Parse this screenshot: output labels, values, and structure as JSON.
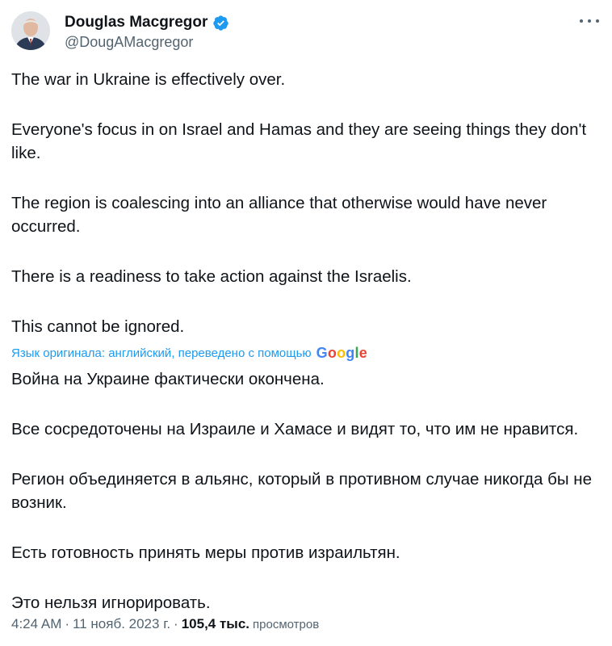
{
  "author": {
    "display_name": "Douglas Macgregor",
    "handle": "@DougAMacgregor",
    "verified_color": "#1d9bf0"
  },
  "menu": {
    "icon": "more-horizontal-icon"
  },
  "original": {
    "paragraphs": [
      "The war in Ukraine is effectively over.",
      "Everyone's focus in on Israel and Hamas and they are seeing things they don't like.",
      "The region is coalescing into an alliance that otherwise would have never occurred.",
      "There is a readiness to take action against the Israelis.",
      "This cannot be ignored."
    ]
  },
  "translation": {
    "notice": "Язык оригинала: английский, переведено с помощью",
    "provider": {
      "g1": "G",
      "o1": "o",
      "o2": "o",
      "g2": "g",
      "l": "l",
      "e": "e"
    },
    "paragraphs": [
      "Война на Украине фактически окончена.",
      "Все сосредоточены на Израиле и Хамасе и видят то, что им не нравится.",
      "Регион объединяется в альянс, который в противном случае никогда бы не возник.",
      "Есть готовность принять меры против израильтян.",
      "Это нельзя игнорировать."
    ]
  },
  "meta": {
    "time": "4:24 AM",
    "sep1": "·",
    "date": "11 нояб. 2023 г.",
    "sep2": "·",
    "views_count": "105,4 тыс.",
    "views_label": "просмотров"
  },
  "colors": {
    "text": "#0f1419",
    "secondary": "#536471",
    "link": "#1d9bf0"
  }
}
